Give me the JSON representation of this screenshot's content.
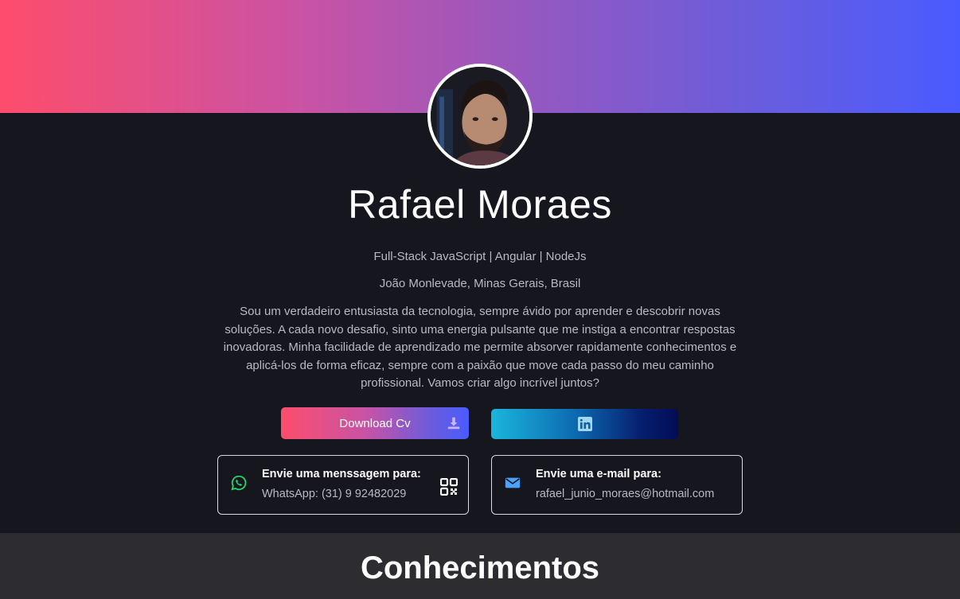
{
  "profile": {
    "name": "Rafael Moraes",
    "headline": "Full-Stack JavaScript | Angular | NodeJs",
    "location": "João Monlevade, Minas Gerais, Brasil",
    "bio": "Sou um verdadeiro entusiasta da tecnologia, sempre ávido por aprender e descobrir novas soluções. A cada novo desafio, sinto uma energia pulsante que me instiga a encontrar respostas inovadoras. Minha facilidade de aprendizado me permite absorver rapidamente conhecimentos e aplicá-los de forma eficaz, sempre com a paixão que move cada passo do meu caminho profissional. Vamos criar algo incrível juntos?"
  },
  "buttons": {
    "download_label": "Download Cv",
    "download_icon": "download-icon",
    "linkedin_icon": "linkedin-icon"
  },
  "contacts": {
    "whatsapp": {
      "title": "Envie uma menssagem para:",
      "value": "WhatsApp: (31) 9 92482029",
      "icon": "whatsapp-icon",
      "action_icon": "qr-code-icon"
    },
    "email": {
      "title": "Envie uma e-mail para:",
      "value": "rafael_junio_moraes@hotmail.com",
      "icon": "mail-icon"
    }
  },
  "skills": {
    "title": "Conhecimentos"
  },
  "colors": {
    "page_bg": "#16161e",
    "section_bg": "#2c2c31",
    "whatsapp_green": "#25d366",
    "mail_blue": "#4aa3ff",
    "text_muted": "#b9b9c3"
  }
}
